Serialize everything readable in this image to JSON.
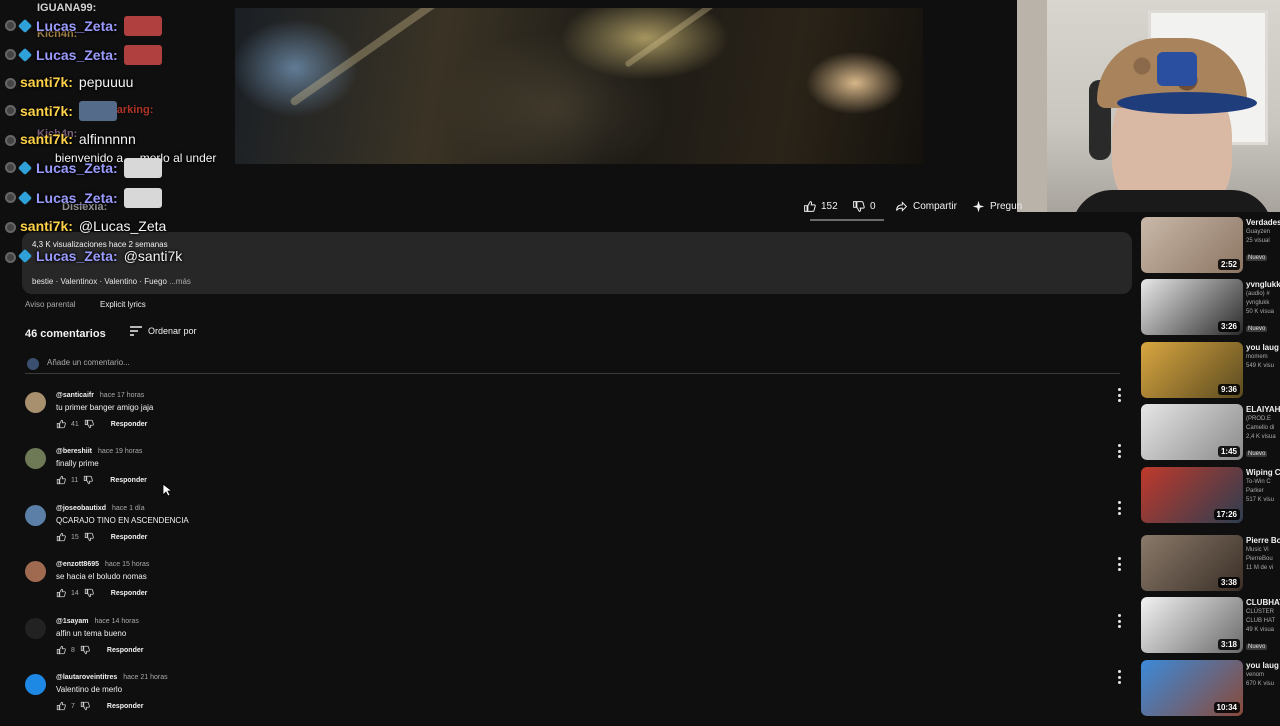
{
  "video": {
    "accent": "#d8c28a"
  },
  "actions": {
    "likes": "152",
    "dislikes": "0",
    "share_label": "Compartir",
    "ask_label": "Pregun"
  },
  "description": {
    "meta": "4,3 K visualizaciones  hace 2 semanas",
    "tags": "bestie · Valentinox · Valentino · Fuego",
    "more": "...más",
    "parental": "Aviso parental",
    "explicit": "Explicit lyrics"
  },
  "comments_section": {
    "count_label": "46 comentarios",
    "sort_label": "Ordenar por",
    "add_placeholder": "Añade un comentario...",
    "reply_label": "Responder",
    "items": [
      {
        "author": "@santicaifr",
        "time": "hace 17 horas",
        "text": "tu primer banger amigo jaja",
        "likes": "41",
        "avatar_color": "#a88f6e"
      },
      {
        "author": "@bereshiit",
        "time": "hace 19 horas",
        "text": "finally prime",
        "likes": "11",
        "avatar_color": "#6e7a55"
      },
      {
        "author": "@joseobautixd",
        "time": "hace 1 día",
        "text": "QCARAJO TINO EN ASCENDENCIA",
        "likes": "15",
        "avatar_color": "#5b7fa6"
      },
      {
        "author": "@enzott8695",
        "time": "hace 15 horas",
        "text": "se hacia el boludo nomas",
        "likes": "14",
        "avatar_color": "#a06a50"
      },
      {
        "author": "@1sayam",
        "time": "hace 14 horas",
        "text": "alfin un tema bueno",
        "likes": "8",
        "avatar_color": "#222222"
      },
      {
        "author": "@lautaroveintitres",
        "time": "hace 21 horas",
        "text": "Valentino de merlo",
        "likes": "7",
        "avatar_color": "#1e88e5"
      }
    ]
  },
  "sidebar": [
    {
      "title": "Verdades",
      "line2": "Guayzen",
      "line3": "25 visual",
      "badge": "Nuevo",
      "duration": "2:52",
      "colors": [
        "#c9b8a8",
        "#8c7563"
      ]
    },
    {
      "title": "yvnglukk",
      "line2": "(audio) #",
      "line3": "yvnglukk",
      "line4": "50 K visua",
      "badge": "Nuevo",
      "duration": "3:26",
      "colors": [
        "#e8e8e8",
        "#2a2a2a"
      ]
    },
    {
      "title": "you laug",
      "line2": "momem",
      "line3": "549 K visu",
      "duration": "9:36",
      "colors": [
        "#d9a640",
        "#5a4a20"
      ]
    },
    {
      "title": "ELAIYAH",
      "line2": "(PROD.E",
      "line3": "Camello di",
      "line4": "2,4 K visua",
      "badge": "Nuevo",
      "duration": "1:45",
      "colors": [
        "#e6e6e6",
        "#8a8a8a"
      ]
    },
    {
      "title": "Wiping C",
      "line2": "To-Win C",
      "line3": "Parker",
      "line4": "517 K visu",
      "duration": "17:26",
      "colors": [
        "#c0392b",
        "#2c3e50"
      ]
    },
    {
      "title": "Pierre Bo",
      "line2": "Music Vi",
      "line3": "PierreBou",
      "line4": "11 M de vi",
      "duration": "3:38",
      "colors": [
        "#8a7a6a",
        "#3a2e26"
      ]
    },
    {
      "title": "CLUBHAT",
      "line2": "CLÚSTER",
      "line3": "CLUB HAT",
      "line4": "49 K visua",
      "badge": "Nuevo",
      "duration": "3:18",
      "colors": [
        "#f2f2f2",
        "#6a6a6a"
      ]
    },
    {
      "title": "you laug",
      "line2": "venom",
      "line3": "670 K visu",
      "duration": "10:34",
      "colors": [
        "#3b8ad9",
        "#8a4a3a"
      ]
    }
  ],
  "chat": {
    "ghosts": [
      "IGUANA99:",
      "Kich4n:",
      "Kich4n:",
      "darking:",
      "Dislexia:"
    ],
    "lines": [
      {
        "user": "Lucas_Zeta:",
        "msg": "",
        "user_color": "#9b9bff",
        "gem": true,
        "emote": "#b04040"
      },
      {
        "user": "Lucas_Zeta:",
        "msg": "",
        "user_color": "#9b9bff",
        "gem": true,
        "emote": "#b04040"
      },
      {
        "user": "santi7k:",
        "msg": "pepuuuu",
        "user_color": "#ffd24a",
        "gem": false,
        "emote": ""
      },
      {
        "user": "santi7k:",
        "msg": "",
        "user_color": "#ffd24a",
        "gem": false,
        "emote": "#556b8a"
      },
      {
        "user": "santi7k:",
        "msg": "alfinnnnn",
        "user_color": "#ffd24a",
        "gem": false,
        "emote": ""
      },
      {
        "user": "",
        "msg": "bienvenido a ... merlo al under",
        "user_color": "#f5f5f5",
        "gem": false,
        "emote": ""
      },
      {
        "user": "Lucas_Zeta:",
        "msg": "",
        "user_color": "#9b9bff",
        "gem": true,
        "emote": "#d8d8d8"
      },
      {
        "user": "Lucas_Zeta:",
        "msg": "",
        "user_color": "#9b9bff",
        "gem": true,
        "emote": "#d8d8d8"
      },
      {
        "user": "santi7k:",
        "msg": "@Lucas_Zeta",
        "user_color": "#ffd24a",
        "gem": false,
        "emote": ""
      },
      {
        "user": "Lucas_Zeta:",
        "msg": "@santi7k",
        "user_color": "#9b9bff",
        "gem": true,
        "emote": ""
      }
    ]
  }
}
